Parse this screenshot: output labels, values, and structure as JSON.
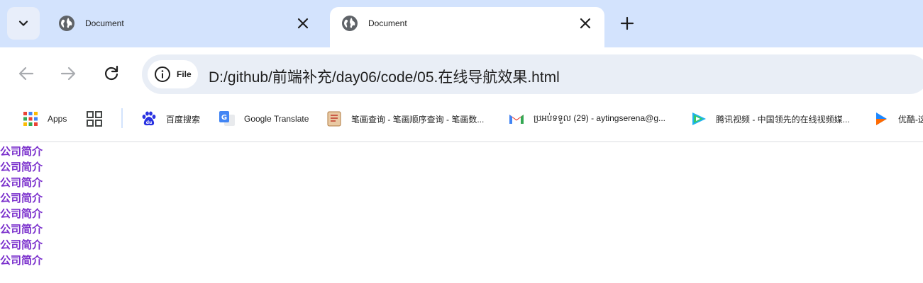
{
  "tabs": [
    {
      "title": "Document",
      "icon": "globe-icon",
      "active": false
    },
    {
      "title": "Document",
      "icon": "globe-icon",
      "active": true
    }
  ],
  "omnibox": {
    "chip_label": "File",
    "url": "D:/github/前端补充/day06/code/05.在线导航效果.html"
  },
  "bookmarks": [
    {
      "label": "Apps",
      "icon": "apps-grid-icon"
    },
    {
      "label": "",
      "icon": "tab-groups-icon"
    },
    {
      "label": "百度搜索",
      "icon": "baidu-icon"
    },
    {
      "label": "Google Translate",
      "icon": "google-translate-icon"
    },
    {
      "label": "笔画查询 - 笔画顺序查询 - 笔画数...",
      "icon": "notebook-icon"
    },
    {
      "label": "ប្រអប់ទទួល (29) - aytingserena@g...",
      "icon": "gmail-icon"
    },
    {
      "label": "腾讯视频 - 中国领先的在线视频媒...",
      "icon": "tencent-video-icon"
    },
    {
      "label": "优酷-这",
      "icon": "youku-icon"
    }
  ],
  "links": [
    "公司简介",
    "公司简介",
    "公司简介",
    "公司简介",
    "公司简介",
    "公司简介",
    "公司简介",
    "公司简介"
  ],
  "colors": {
    "tab_strip": "#d3e3fd",
    "omnibox": "#e9eef6",
    "link": "#7a2fcc"
  }
}
